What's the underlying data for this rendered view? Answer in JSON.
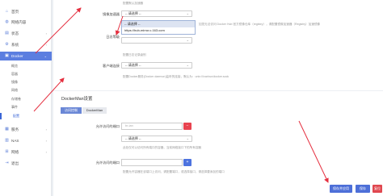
{
  "sidebar": {
    "items": [
      {
        "label": "首页",
        "icon": "home-icon"
      },
      {
        "label": "网络内容",
        "icon": "globe-icon"
      },
      {
        "label": "状态",
        "icon": "status-icon"
      },
      {
        "label": "系统",
        "icon": "gear-icon"
      },
      {
        "label": "Docker",
        "icon": "docker-icon"
      },
      {
        "label": "服务",
        "icon": "service-icon"
      },
      {
        "label": "NAS",
        "icon": "nas-icon"
      },
      {
        "label": "网络",
        "icon": "network-icon"
      },
      {
        "label": "退出",
        "icon": "logout-icon"
      }
    ],
    "docker_subitems": [
      "概览",
      "容器",
      "镜像",
      "网络",
      "存储卷",
      "事件",
      "配置"
    ]
  },
  "config": {
    "top_hint": "配置默认加速器",
    "mirror_label": "镜像加速器",
    "mirror_select_value": "-- 请选择 --",
    "dropdown_options": [
      "-- 请选择 --",
      "https://hub-mirror.c.163.com"
    ],
    "mirror_hint": "如您无法访问 Docker Hub 官方镜像仓库（registry），请配置镜像加速器（Registry）加速镜像",
    "log_label": "日志等级",
    "log_hint": "配置日志记录级别",
    "client_label": "客户端连接",
    "client_select_value": "-- 请选择 --",
    "client_hint": "配置Docker服务(Docker daemon)监听的连接，默认为：unix:///var/run/docker.sock"
  },
  "dockerman": {
    "title": "DockerMan设置",
    "tabs": [
      "访问控制",
      "DockerMan"
    ],
    "allowed_label": "允许访问的端口",
    "allowed_input_placeholder": "br-lan",
    "allowed_select_value": "-- 请选择 --",
    "allowed_hint": "此处仅可以访问所有端口的容器，当前网络接口下的所有容器",
    "allowed2_label": "允许访问的端口",
    "allowed2_input_placeholder": "",
    "allowed2_hint": "配置允许容器在该端口上访问，请配置端口，或选择接口，请选择要添加的端口"
  },
  "footer": {
    "save_apply_label": "保存并应用",
    "save_label": "保存",
    "reset_label": "复位"
  },
  "colors": {
    "accent": "#5b7ee0",
    "danger": "#e8434f",
    "annotation_arrow": "#e53040"
  }
}
